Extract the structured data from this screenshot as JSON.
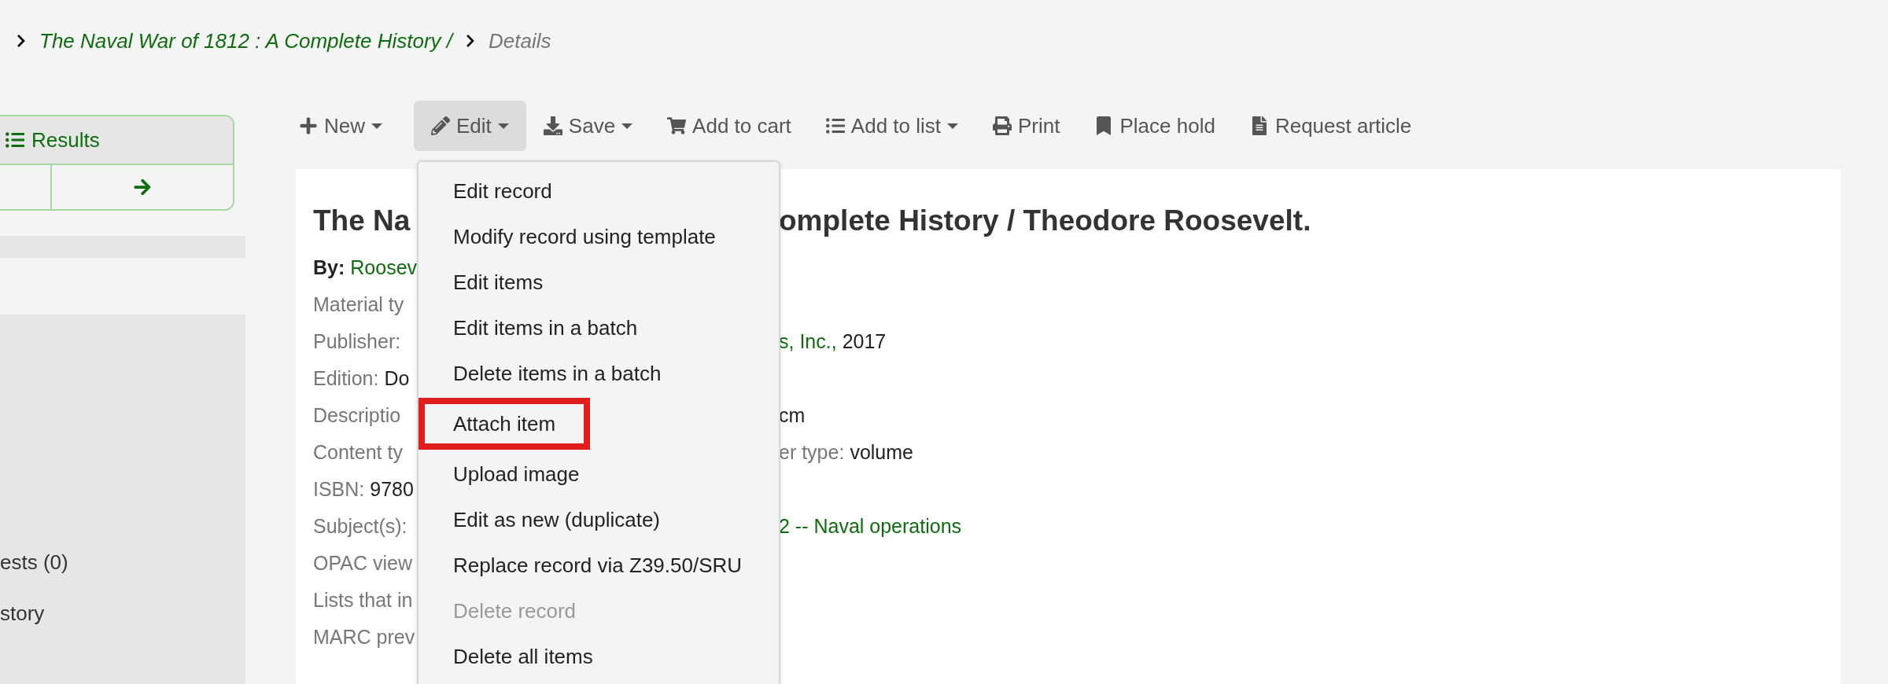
{
  "breadcrumb": [
    {
      "text": "The Naval War of 1812 : A Complete History /",
      "kind": "link"
    },
    {
      "text": "Details",
      "kind": "current"
    }
  ],
  "results_panel": {
    "label": "Results"
  },
  "sidebar_items": [
    "ests (0)",
    "story"
  ],
  "toolbar": [
    {
      "label": "New",
      "caret": true,
      "selected": false
    },
    {
      "label": "Edit",
      "caret": true,
      "selected": true
    },
    {
      "label": "Save",
      "caret": true,
      "selected": false
    },
    {
      "label": "Add to cart",
      "caret": false,
      "selected": false
    },
    {
      "label": "Add to list",
      "caret": true,
      "selected": false
    },
    {
      "label": "Print",
      "caret": false,
      "selected": false
    },
    {
      "label": "Place hold",
      "caret": false,
      "selected": false
    },
    {
      "label": "Request article",
      "caret": false,
      "selected": false
    }
  ],
  "record": {
    "title_left": "The Na",
    "title_right": "omplete History / Theodore Roosevelt.",
    "rows": [
      {
        "left": [
          {
            "text": "By:",
            "kind": "strong"
          },
          {
            "text": "Roosev",
            "kind": "link"
          }
        ],
        "right": []
      },
      {
        "left": [
          {
            "text": "Material ty",
            "kind": "label"
          }
        ],
        "right": []
      },
      {
        "left": [
          {
            "text": "Publisher:",
            "kind": "label"
          }
        ],
        "right": [
          {
            "text": "s, Inc.,",
            "kind": "link"
          },
          {
            "text": "2017",
            "kind": "value"
          }
        ]
      },
      {
        "left": [
          {
            "text": "Edition:",
            "kind": "label"
          },
          {
            "text": "Do",
            "kind": "value"
          }
        ],
        "right": []
      },
      {
        "left": [
          {
            "text": "Descriptio",
            "kind": "label"
          }
        ],
        "right": [
          {
            "text": "cm",
            "kind": "value"
          }
        ]
      },
      {
        "left": [
          {
            "text": "Content ty",
            "kind": "label"
          }
        ],
        "right": [
          {
            "text": "er type:",
            "kind": "label"
          },
          {
            "text": "volume",
            "kind": "value"
          }
        ]
      },
      {
        "left": [
          {
            "text": "ISBN:",
            "kind": "label"
          },
          {
            "text": "9780",
            "kind": "value"
          }
        ],
        "right": []
      },
      {
        "left": [
          {
            "text": "Subject(s):",
            "kind": "label"
          }
        ],
        "right": [
          {
            "text": "2 -- Naval operations",
            "kind": "link"
          }
        ]
      },
      {
        "left": [
          {
            "text": "OPAC view",
            "kind": "label"
          }
        ],
        "right": []
      },
      {
        "left": [
          {
            "text": "Lists that in",
            "kind": "label"
          }
        ],
        "right": []
      },
      {
        "left": [
          {
            "text": "MARC prev",
            "kind": "label"
          }
        ],
        "right": []
      }
    ]
  },
  "edit_menu": [
    {
      "label": "Edit record",
      "disabled": false,
      "highlighted": false
    },
    {
      "label": "Modify record using template",
      "disabled": false,
      "highlighted": false
    },
    {
      "label": "Edit items",
      "disabled": false,
      "highlighted": false
    },
    {
      "label": "Edit items in a batch",
      "disabled": false,
      "highlighted": false
    },
    {
      "label": "Delete items in a batch",
      "disabled": false,
      "highlighted": false
    },
    {
      "label": "Attach item",
      "disabled": false,
      "highlighted": true
    },
    {
      "label": "Upload image",
      "disabled": false,
      "highlighted": false
    },
    {
      "label": "Edit as new (duplicate)",
      "disabled": false,
      "highlighted": false
    },
    {
      "label": "Replace record via Z39.50/SRU",
      "disabled": false,
      "highlighted": false
    },
    {
      "label": "Delete record",
      "disabled": true,
      "highlighted": false
    },
    {
      "label": "Delete all items",
      "disabled": false,
      "highlighted": false
    }
  ]
}
